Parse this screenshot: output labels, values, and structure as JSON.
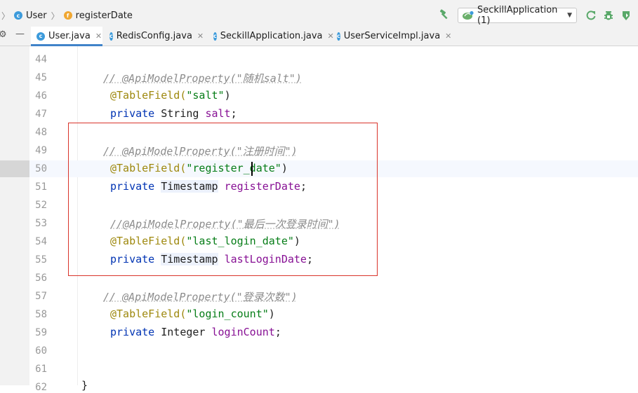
{
  "breadcrumb": {
    "class_label": "User",
    "class_icon_letter": "c",
    "field_label": "registerDate",
    "field_icon_letter": "f"
  },
  "toolbar": {
    "run_config": "SeckillApplication (1)"
  },
  "tabs": [
    {
      "label": "User.java",
      "active": true
    },
    {
      "label": "RedisConfig.java",
      "active": false
    },
    {
      "label": "SeckillApplication.java",
      "active": false
    },
    {
      "label": "UserServiceImpl.java",
      "active": false
    }
  ],
  "editor": {
    "line_numbers": [
      "44",
      "45",
      "46",
      "47",
      "48",
      "49",
      "50",
      "51",
      "52",
      "53",
      "54",
      "55",
      "56",
      "57",
      "58",
      "59",
      "60",
      "61",
      "62"
    ],
    "current_line": "50",
    "lines": {
      "l45": {
        "comment": "// @ApiModelProperty(\"随机salt\")"
      },
      "l46": {
        "annotation": "@TableField(",
        "string": "\"salt\"",
        "close": ")"
      },
      "l47": {
        "keyword": "private",
        "type": "String",
        "field": "salt",
        "end": ";"
      },
      "l49": {
        "comment": "// @ApiModelProperty(\"注册时间\")"
      },
      "l50": {
        "annotation": "@TableField(",
        "string": "\"register_date\"",
        "close": ")"
      },
      "l51": {
        "keyword": "private",
        "type": "Timestamp",
        "field": "registerDate",
        "end": ";"
      },
      "l53": {
        "comment": "//@ApiModelProperty(\"最后一次登录时间\")"
      },
      "l54": {
        "annotation": "@TableField(",
        "string": "\"last_login_date\"",
        "close": ")"
      },
      "l55": {
        "keyword": "private",
        "type": "Timestamp",
        "field": "lastLoginDate",
        "end": ";"
      },
      "l57": {
        "comment": "// @ApiModelProperty(\"登录次数\")"
      },
      "l58": {
        "annotation": "@TableField(",
        "string": "\"login_count\"",
        "close": ")"
      },
      "l59": {
        "keyword": "private",
        "type": "Integer",
        "field": "loginCount",
        "end": ";"
      },
      "l62": {
        "brace": "}"
      }
    }
  },
  "colors": {
    "annotation": "#9e880d",
    "string": "#067d17",
    "keyword": "#0033b3",
    "field": "#871094",
    "comment": "#8c8c8c",
    "highlight_box": "#d9342b",
    "active_tab_underline": "#4083c9"
  },
  "icons": [
    "gear-icon",
    "minimize-icon",
    "class-icon",
    "field-icon",
    "hammer-icon",
    "run-config-icon",
    "dropdown-chevron-icon",
    "rerun-icon",
    "debug-icon",
    "coverage-icon"
  ]
}
